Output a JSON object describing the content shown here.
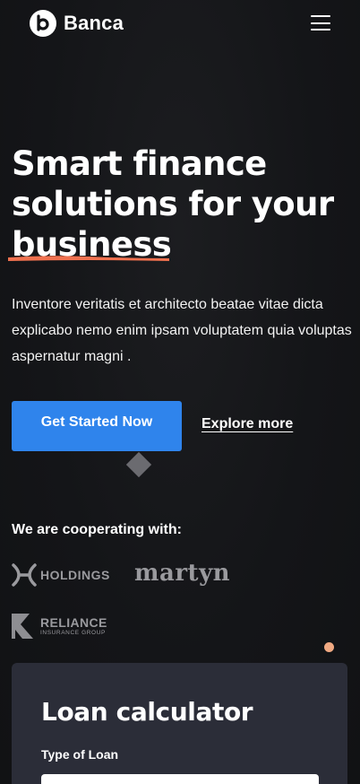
{
  "header": {
    "brand": "Banca",
    "logo_letter": "b",
    "menu_icon": "hamburger-menu-icon"
  },
  "hero": {
    "title_line1": "Smart finance",
    "title_line2": "solutions for your",
    "title_line3": "business",
    "description": "Inventore veritatis et architecto beatae vitae dicta explicabo nemo enim ipsam voluptatem quia voluptas aspernatur magni .",
    "primary_cta": "Get Started Now",
    "secondary_cta": "Explore more",
    "underline_color": "#f0714f"
  },
  "partners": {
    "heading": "We are cooperating with:",
    "items": [
      {
        "name": "HOLDINGS",
        "icon": "holdings-logo-icon"
      },
      {
        "name": "martyn",
        "icon": "martyn-logo-icon"
      },
      {
        "name": "RELIANCE",
        "subtitle": "INSURANCE GROUP",
        "icon": "reliance-logo-icon"
      }
    ]
  },
  "calculator": {
    "title": "Loan calculator",
    "type_label": "Type of Loan"
  },
  "colors": {
    "accent": "#2f84ec",
    "background": "#141518",
    "card": "#2b2d38",
    "highlight": "#f0714f",
    "dot": "#f0a982"
  }
}
